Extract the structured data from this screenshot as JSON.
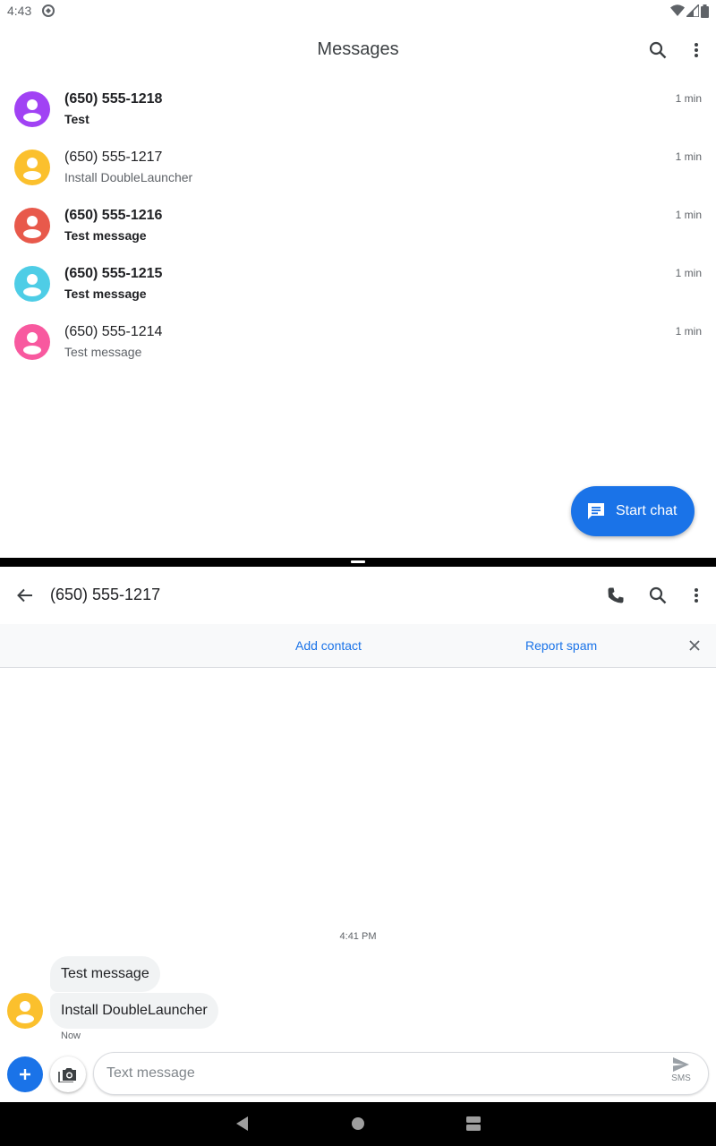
{
  "status_bar": {
    "time": "4:43"
  },
  "top_pane": {
    "title": "Messages",
    "conversations": [
      {
        "name": "(650) 555-1218",
        "snippet": "Test",
        "time": "1 min",
        "unread": true,
        "avatar_color": "#a142f4"
      },
      {
        "name": "(650) 555-1217",
        "snippet": "Install DoubleLauncher",
        "time": "1 min",
        "unread": false,
        "avatar_color": "#fbc02d"
      },
      {
        "name": "(650) 555-1216",
        "snippet": "Test message",
        "time": "1 min",
        "unread": true,
        "avatar_color": "#e8594b"
      },
      {
        "name": "(650) 555-1215",
        "snippet": "Test message",
        "time": "1 min",
        "unread": true,
        "avatar_color": "#4ecde6"
      },
      {
        "name": "(650) 555-1214",
        "snippet": "Test message",
        "time": "1 min",
        "unread": false,
        "avatar_color": "#f8599f"
      }
    ],
    "fab_label": "Start chat"
  },
  "bottom_pane": {
    "title": "(650) 555-1217",
    "banner": {
      "add_contact": "Add contact",
      "report_spam": "Report spam"
    },
    "timestamp": "4:41 PM",
    "messages": [
      {
        "text": "Test message"
      },
      {
        "text": "Install DoubleLauncher"
      }
    ],
    "message_status": "Now",
    "sender_avatar_color": "#fbc02d",
    "compose": {
      "placeholder": "Text message",
      "send_label": "SMS"
    }
  },
  "colors": {
    "accent": "#1a73e8"
  }
}
